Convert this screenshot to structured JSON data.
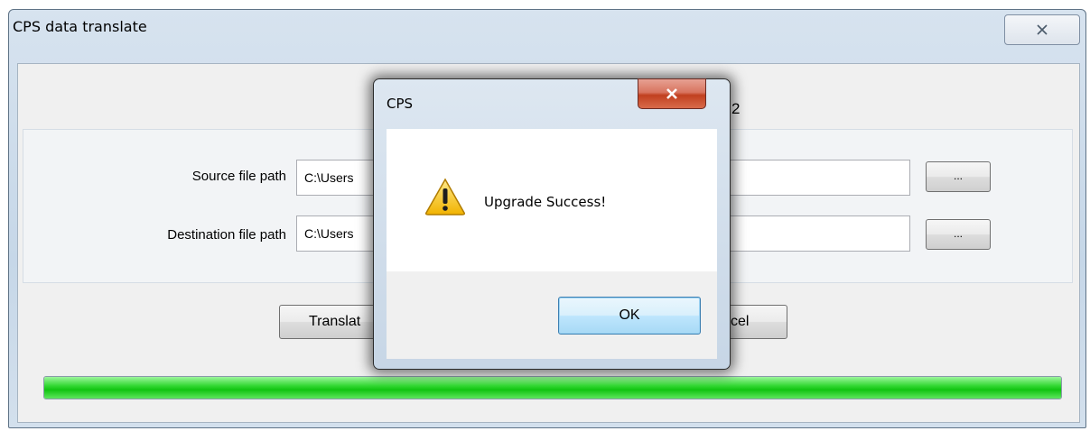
{
  "main_window": {
    "title": "CPS data translate",
    "partial_label": "2",
    "source_label": "Source file path",
    "source_value": "C:\\Users",
    "destination_label": "Destination file path",
    "destination_value": "C:\\Users",
    "browse_label": "...",
    "translate_label": "Translat",
    "cancel_label": "cel",
    "progress": 1.0,
    "close_icon": "close-icon"
  },
  "dialog": {
    "title": "CPS",
    "message": "Upgrade Success!",
    "ok_label": "OK",
    "icon": "warning-icon",
    "close_icon": "close-icon"
  }
}
